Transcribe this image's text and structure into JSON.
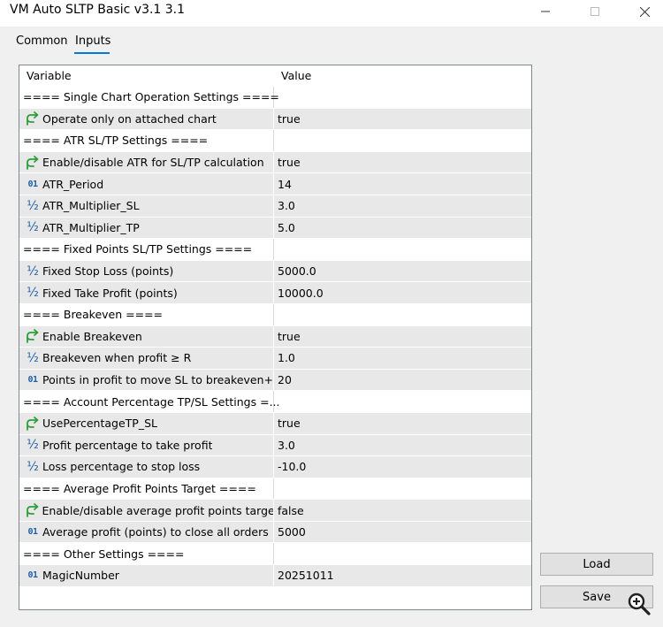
{
  "window": {
    "title": "VM Auto SLTP Basic v3.1 3.1"
  },
  "tabs": [
    {
      "label": "Common"
    },
    {
      "label": "Inputs"
    }
  ],
  "grid": {
    "col_variable": "Variable",
    "col_value": "Value",
    "rows": [
      {
        "type": "header",
        "label": "==== Single Chart Operation Settings ====",
        "value": ""
      },
      {
        "type": "bool",
        "label": "Operate only on attached chart",
        "value": "true"
      },
      {
        "type": "header",
        "label": "==== ATR SL/TP Settings ====",
        "value": ""
      },
      {
        "type": "bool",
        "label": "Enable/disable ATR for SL/TP calculation",
        "value": "true"
      },
      {
        "type": "int",
        "label": "ATR_Period",
        "value": "14"
      },
      {
        "type": "double",
        "label": "ATR_Multiplier_SL",
        "value": "3.0"
      },
      {
        "type": "double",
        "label": "ATR_Multiplier_TP",
        "value": "5.0"
      },
      {
        "type": "header",
        "label": "==== Fixed Points SL/TP Settings ====",
        "value": ""
      },
      {
        "type": "double",
        "label": "Fixed Stop Loss (points)",
        "value": "5000.0"
      },
      {
        "type": "double",
        "label": "Fixed Take Profit (points)",
        "value": "10000.0"
      },
      {
        "type": "header",
        "label": "==== Breakeven ====",
        "value": ""
      },
      {
        "type": "bool",
        "label": "Enable Breakeven",
        "value": "true"
      },
      {
        "type": "double",
        "label": "Breakeven when profit ≥ R",
        "value": "1.0"
      },
      {
        "type": "int",
        "label": "Points in profit to move SL to breakeven+",
        "value": "20"
      },
      {
        "type": "header",
        "label": "==== Account Percentage TP/SL Settings =...",
        "value": ""
      },
      {
        "type": "bool",
        "label": "UsePercentageTP_SL",
        "value": "true"
      },
      {
        "type": "double",
        "label": "Profit percentage to take profit",
        "value": "3.0"
      },
      {
        "type": "double",
        "label": "Loss percentage to stop loss",
        "value": "-10.0"
      },
      {
        "type": "header",
        "label": "==== Average Profit Points Target ====",
        "value": ""
      },
      {
        "type": "bool",
        "label": "Enable/disable average profit points target",
        "value": "false"
      },
      {
        "type": "int",
        "label": "Average profit (points) to close all orders",
        "value": "5000"
      },
      {
        "type": "header",
        "label": "==== Other Settings ====",
        "value": ""
      },
      {
        "type": "int",
        "label": "MagicNumber",
        "value": "20251011"
      }
    ]
  },
  "icons": {
    "bool": "arrow-branch-icon",
    "int": "integer-01-icon",
    "double": "fraction-half-icon"
  },
  "icon_glyphs": {
    "int": "01",
    "double": "½"
  },
  "buttons": {
    "load": "Load",
    "save": "Save"
  },
  "colors": {
    "accent": "#0078d7",
    "icon_green": "#2e9e3a",
    "icon_blue": "#1f5fa8",
    "row_shade": "#e8e8e8"
  }
}
